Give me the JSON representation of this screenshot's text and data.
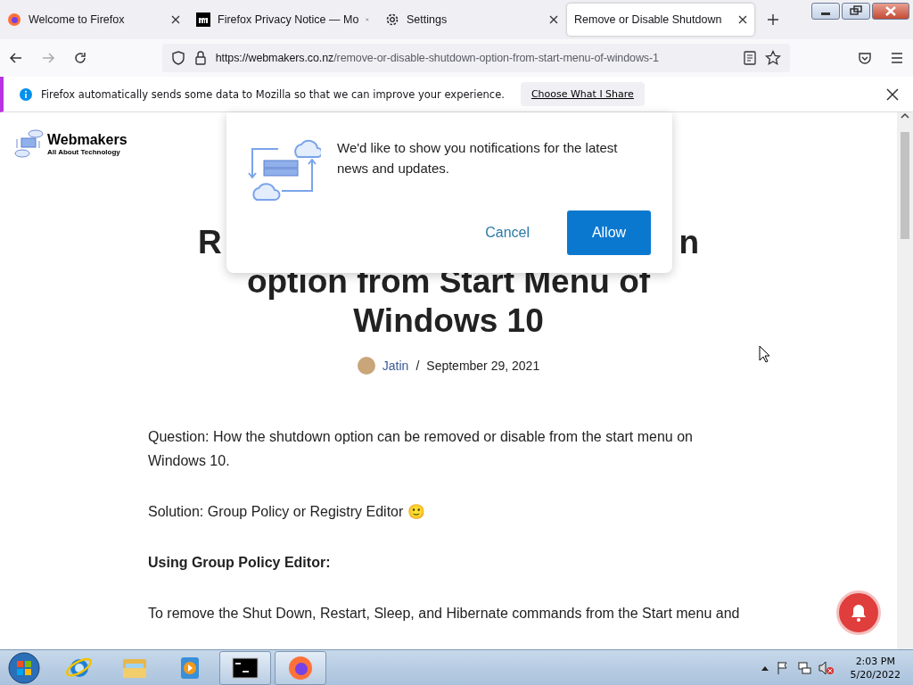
{
  "tabs": [
    {
      "label": "Welcome to Firefox",
      "kind": "firefox",
      "selected": false
    },
    {
      "label": "Firefox Privacy Notice — Mo",
      "kind": "mozilla",
      "selected": false
    },
    {
      "label": "Settings",
      "kind": "gear",
      "selected": false
    },
    {
      "label": "Remove or Disable Shutdown",
      "kind": "plain",
      "selected": true
    }
  ],
  "address": {
    "host": "https://webmakers.co.nz",
    "path": "/remove-or-disable-shutdown-option-from-start-menu-of-windows-1"
  },
  "info_bar": {
    "message": "Firefox automatically sends some data to Mozilla so that we can improve your experience.",
    "button": "Choose What I Share"
  },
  "site": {
    "logo_name": "Webmakers",
    "logo_tagline": "All About Technology"
  },
  "article": {
    "title_covered_line": [
      "R",
      "n"
    ],
    "title_lines": [
      "option from Start Menu of",
      "Windows 10"
    ],
    "author": "Jatin",
    "separator": "/",
    "date": "September 29, 2021",
    "paragraphs": [
      {
        "kind": "text",
        "text": "Question: How the shutdown option can be removed or disable from the start menu on Windows 10."
      },
      {
        "kind": "text",
        "text": "Solution: Group Policy or Registry Editor 🙂"
      },
      {
        "kind": "heading",
        "text": "Using Group Policy Editor:"
      },
      {
        "kind": "text",
        "text": "To remove the Shut Down, Restart, Sleep, and Hibernate commands from the Start menu and"
      }
    ]
  },
  "notification_prompt": {
    "message": "We'd like to show you notifications for the latest news and updates.",
    "cancel": "Cancel",
    "allow": "Allow"
  },
  "taskbar": {
    "apps": [
      {
        "kind": "ie",
        "active": false
      },
      {
        "kind": "folder",
        "active": false
      },
      {
        "kind": "media",
        "active": false
      },
      {
        "kind": "cmd",
        "active": true
      },
      {
        "kind": "firefox",
        "active": true
      }
    ],
    "time": "2:03 PM",
    "date": "5/20/2022"
  }
}
